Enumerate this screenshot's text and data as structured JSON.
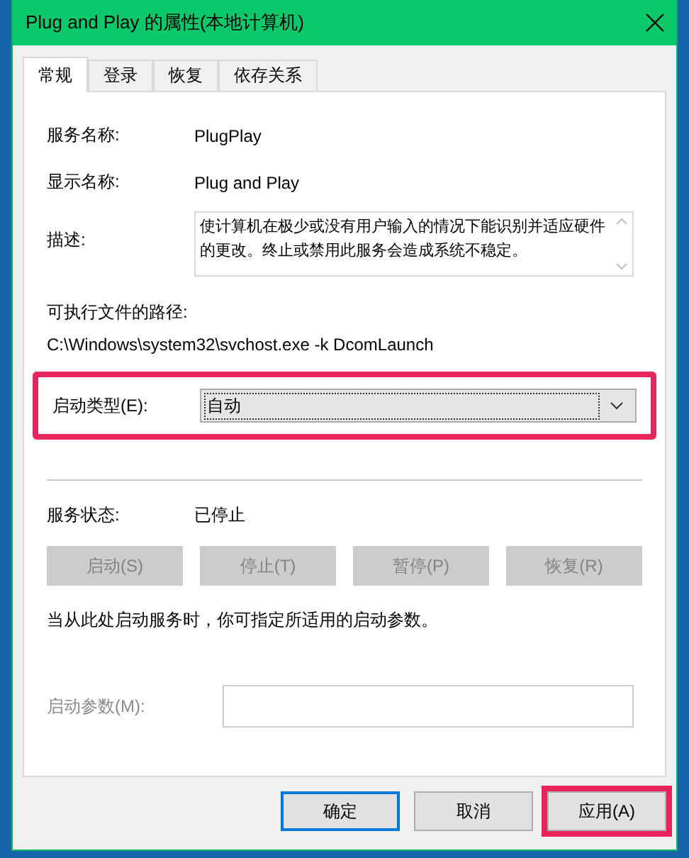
{
  "window": {
    "title": "Plug and Play 的属性(本地计算机)"
  },
  "tabs": [
    {
      "label": "常规",
      "selected": true
    },
    {
      "label": "登录",
      "selected": false
    },
    {
      "label": "恢复",
      "selected": false
    },
    {
      "label": "依存关系",
      "selected": false
    }
  ],
  "service_name": {
    "label": "服务名称:",
    "value": "PlugPlay"
  },
  "display_name": {
    "label": "显示名称:",
    "value": "Plug and Play"
  },
  "description": {
    "label": "描述:",
    "value": "使计算机在极少或没有用户输入的情况下能识别并适应硬件的更改。终止或禁用此服务会造成系统不稳定。"
  },
  "executable_path": {
    "label": "可执行文件的路径:",
    "value": "C:\\Windows\\system32\\svchost.exe -k DcomLaunch"
  },
  "startup_type": {
    "label": "启动类型(E):",
    "value": "自动",
    "highlighted": true
  },
  "service_status": {
    "label": "服务状态:",
    "value": "已停止"
  },
  "service_buttons": [
    {
      "label": "启动(S)",
      "disabled": true
    },
    {
      "label": "停止(T)",
      "disabled": true
    },
    {
      "label": "暂停(P)",
      "disabled": true
    },
    {
      "label": "恢复(R)",
      "disabled": true
    }
  ],
  "hint": "当从此处启动服务时，你可指定所适用的启动参数。",
  "start_parameters": {
    "label": "启动参数(M):",
    "disabled": true
  },
  "buttons": [
    {
      "label": "确定",
      "default": true,
      "highlighted": false
    },
    {
      "label": "取消",
      "default": false,
      "highlighted": false
    },
    {
      "label": "应用(A)",
      "default": false,
      "highlighted": true
    }
  ]
}
